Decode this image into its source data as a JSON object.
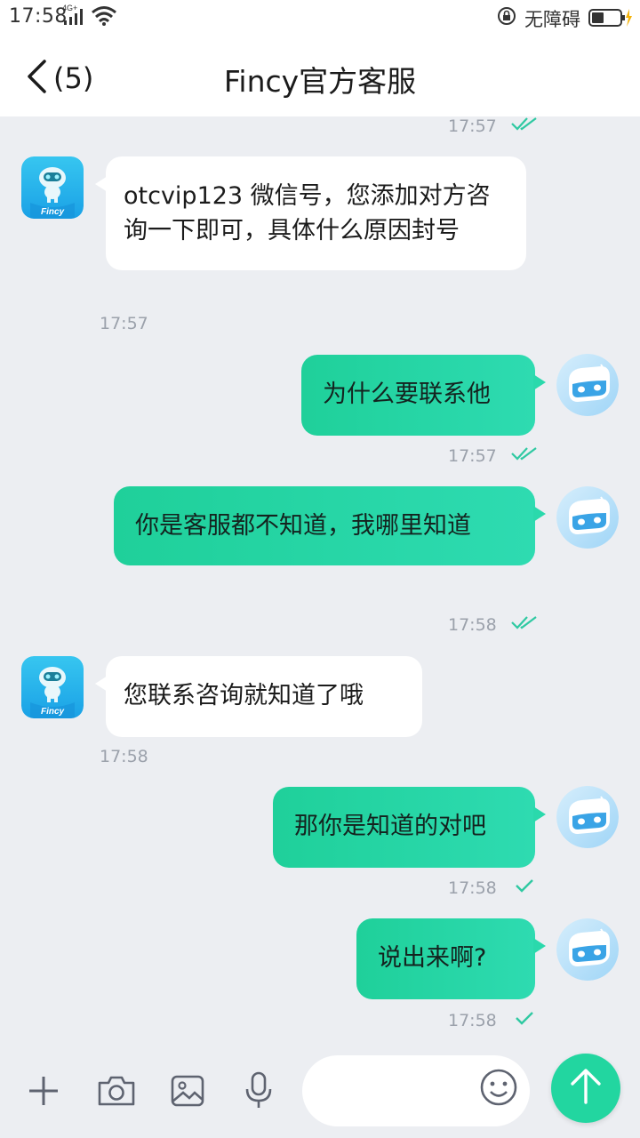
{
  "status_bar": {
    "time": "17:58",
    "network": "4G+",
    "accessibility": "无障碍"
  },
  "header": {
    "back_count": "(5)",
    "title": "Fincy官方客服"
  },
  "messages": [
    {
      "side": "meta",
      "time": "17:57",
      "read": true
    },
    {
      "side": "agent",
      "text": "otcvip123  微信号，您添加对方咨询一下即可，具体什么原因封号",
      "time": "17:57"
    },
    {
      "side": "user",
      "text": "为什么要联系他",
      "time": "17:57",
      "read": true
    },
    {
      "side": "user",
      "text": "你是客服都不知道，我哪里知道",
      "time": "17:58",
      "read": true
    },
    {
      "side": "agent",
      "text": "您联系咨询就知道了哦",
      "time": "17:58"
    },
    {
      "side": "user",
      "text": "那你是知道的对吧",
      "time": "17:58",
      "read": false
    },
    {
      "side": "user",
      "text": "说出来啊?",
      "time": "17:58",
      "read": false
    }
  ],
  "agent_avatar_brand": "Fincy",
  "input": {
    "placeholder": "",
    "value": ""
  },
  "icons": {
    "add": "plus-icon",
    "camera": "camera-icon",
    "image": "image-icon",
    "mic": "microphone-icon",
    "emoji": "emoji-icon",
    "send": "arrow-up-icon"
  },
  "colors": {
    "accent": "#22d6a0",
    "check": "#2fc9a2",
    "background": "#eceef2"
  }
}
